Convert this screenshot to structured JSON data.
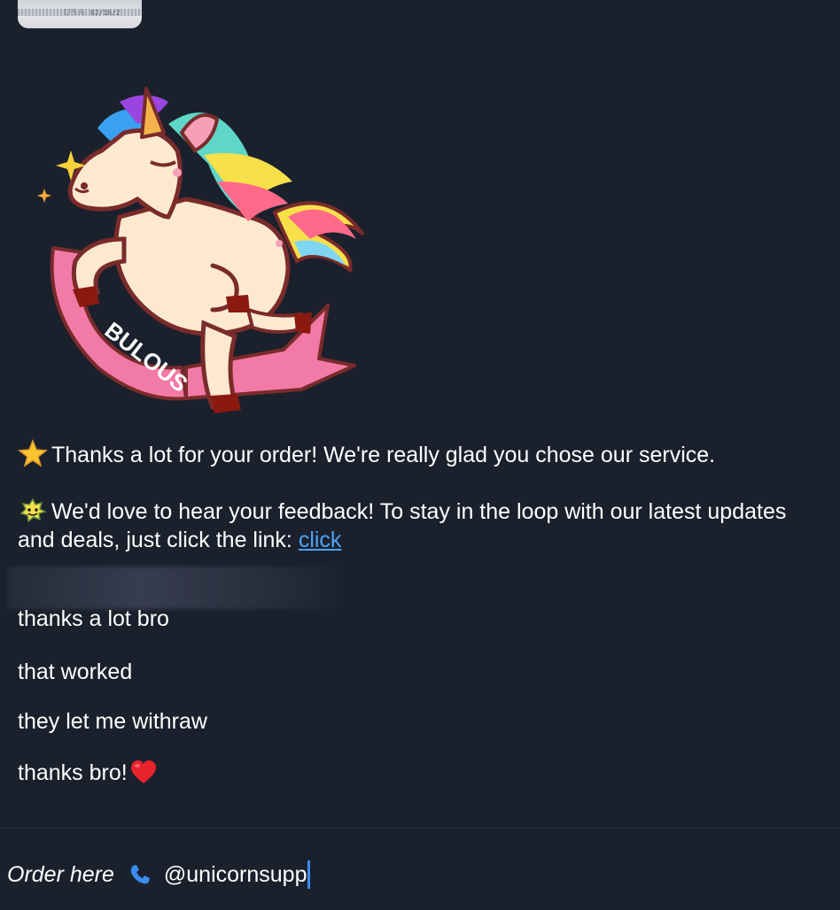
{
  "attachment": {
    "thumb_text_usa": "USA",
    "thumb_text_date": "02/16/2"
  },
  "sticker": {
    "label": "BULOUS",
    "icon": "unicorn-sticker"
  },
  "messages": {
    "order_thanks": "Thanks a lot for your order! We're really glad you chose our service.",
    "feedback_text": "We'd love to hear your feedback! To stay in the loop with our latest updates and deals, just click the link: ",
    "feedback_link": "click"
  },
  "replies": [
    "thanks a lot bro",
    "that worked",
    "they let me withraw",
    "thanks bro!"
  ],
  "footer": {
    "order_label": "Order here",
    "handle": "@unicornsupp"
  },
  "colors": {
    "background": "#1a212c",
    "link": "#4ea3f5",
    "caret": "#3b8df0"
  }
}
